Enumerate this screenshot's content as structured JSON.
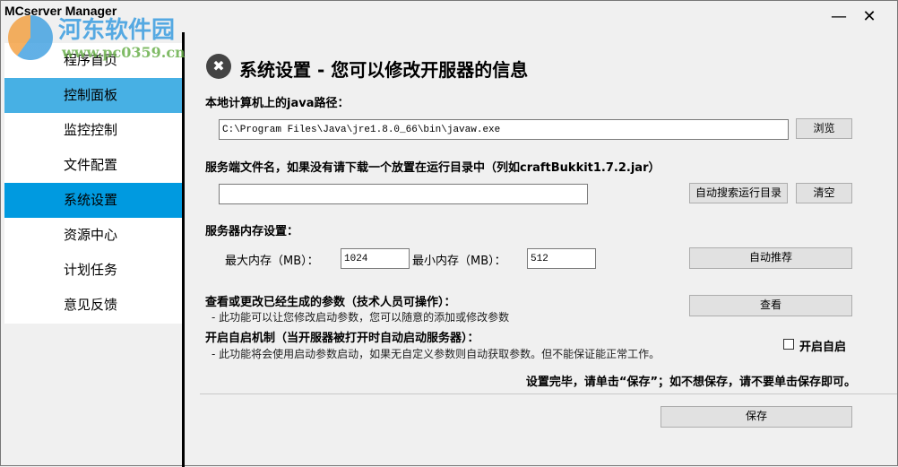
{
  "window": {
    "title": "MCserver Manager",
    "minimize": "—",
    "close": "✕"
  },
  "watermark": {
    "text": "河东软件园",
    "url": "www.pc0359.cn"
  },
  "sidebar": {
    "items": [
      {
        "label": "程序首页"
      },
      {
        "label": "控制面板"
      },
      {
        "label": "监控控制"
      },
      {
        "label": "文件配置"
      },
      {
        "label": "系统设置"
      },
      {
        "label": "资源中心"
      },
      {
        "label": "计划任务"
      },
      {
        "label": "意见反馈"
      }
    ]
  },
  "main": {
    "icon": "tools-icon",
    "heading": "系统设置 - 您可以修改开服器的信息",
    "java_label": "本地计算机上的java路径：",
    "java_path": "C:\\Program Files\\Java\\jre1.8.0_66\\bin\\javaw.exe",
    "browse": "浏览",
    "server_label": "服务端文件名，如果没有请下载一个放置在运行目录中（列如craftBukkit1.7.2.jar）",
    "server_file": "",
    "auto_search": "自动搜索运行目录",
    "clear": "清空",
    "memory_label": "服务器内存设置：",
    "max_mem_label": "最大内存（MB）：",
    "max_mem": "1024",
    "min_mem_label": "最小内存（MB）：",
    "min_mem": "512",
    "auto_recommend": "自动推荐",
    "params_label": "查看或更改已经生成的参数（技术人员可操作）：",
    "params_hint": "- 此功能可以让您修改启动参数，您可以随意的添加或修改参数",
    "view": "查看",
    "autostart_label": "开启自启机制（当开服器被打开时自动启动服务器）：",
    "autostart_hint": "- 此功能将会使用启动参数启动，如果无自定义参数则自动获取参数。但不能保证能正常工作。",
    "autostart_checkbox": "开启自启",
    "autostart_checked": false,
    "notice": "设置完毕，请单击“保存”；如不想保存，请不要单击保存即可。",
    "save": "保存"
  }
}
